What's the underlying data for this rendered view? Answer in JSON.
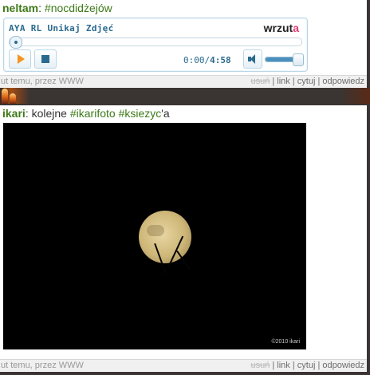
{
  "post1": {
    "user": "neltam",
    "separator": ":",
    "tag": "#nocdidżejów",
    "player": {
      "title": "AYA RL Unikaj Zdjęć",
      "brand_main": "wrzut",
      "brand_accent": "a",
      "time_current": "0:00",
      "time_sep": "/",
      "time_total": "4:58",
      "seek_progress": 0,
      "volume": 0.9
    },
    "footer": {
      "meta": "ut temu, przez WWW",
      "delete": "usuń",
      "link": "link",
      "quote": "cytuj",
      "reply": "odpowiedz",
      "pipe": "|"
    }
  },
  "post2": {
    "user": "ikari",
    "separator": ":",
    "text_prefix": "kolejne",
    "tag1": "#ikarifoto",
    "tag2": "#ksiezyc",
    "text_suffix": "'a",
    "photo_credit": "©2010 ikari",
    "footer": {
      "meta": "ut temu, przez WWW",
      "delete": "usuń",
      "link": "link",
      "quote": "cytuj",
      "reply": "odpowiedz",
      "pipe": "|"
    }
  },
  "colors": {
    "username": "#3d7a18",
    "tag": "#3d7a18",
    "frame": "#3a3432",
    "player_accent": "#2a6a8f",
    "brand_accent": "#e23a74",
    "play": "#f7931e"
  },
  "icons": [
    "play-icon",
    "stop-icon",
    "volume-icon",
    "moon-photo"
  ]
}
